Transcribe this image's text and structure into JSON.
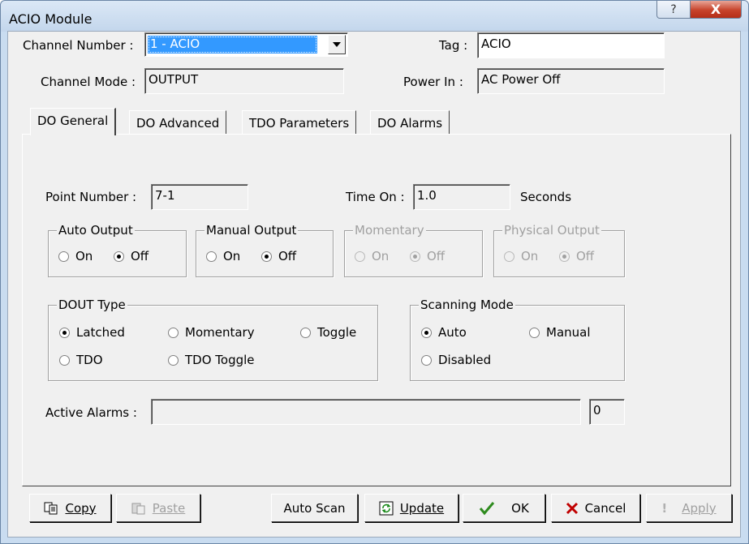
{
  "window": {
    "title": "ACIO Module",
    "help_button": "?",
    "close_button": "X"
  },
  "header": {
    "channel_number_label": "Channel Number :",
    "channel_number_value": "1 - ACIO",
    "tag_label": "Tag :",
    "tag_value": "ACIO",
    "channel_mode_label": "Channel Mode :",
    "channel_mode_value": "OUTPUT",
    "power_in_label": "Power In :",
    "power_in_value": "AC Power Off"
  },
  "tabs": [
    {
      "label": "DO General",
      "active": true
    },
    {
      "label": "DO Advanced",
      "active": false
    },
    {
      "label": "TDO Parameters",
      "active": false
    },
    {
      "label": "DO Alarms",
      "active": false
    }
  ],
  "general": {
    "point_number_label": "Point Number :",
    "point_number_value": "7-1",
    "time_on_label": "Time On :",
    "time_on_value": "1.0",
    "time_on_unit": "Seconds",
    "auto_output": {
      "title": "Auto Output",
      "on": "On",
      "off": "Off",
      "selected": "off"
    },
    "manual_output": {
      "title": "Manual Output",
      "on": "On",
      "off": "Off",
      "selected": "off"
    },
    "momentary": {
      "title": "Momentary",
      "on": "On",
      "off": "Off",
      "selected": "off"
    },
    "physical_output": {
      "title": "Physical Output",
      "on": "On",
      "off": "Off",
      "selected": "off"
    },
    "dout_type": {
      "title": "DOUT Type",
      "latched": "Latched",
      "momentary": "Momentary",
      "toggle": "Toggle",
      "tdo": "TDO",
      "tdo_toggle": "TDO Toggle",
      "selected": "latched"
    },
    "scanning_mode": {
      "title": "Scanning Mode",
      "auto": "Auto",
      "manual": "Manual",
      "disabled": "Disabled",
      "selected": "auto"
    },
    "active_alarms_label": "Active Alarms :",
    "active_alarms_value": "",
    "active_alarms_count": "0"
  },
  "buttons": {
    "copy": "Copy",
    "paste": "Paste",
    "auto_scan": "Auto Scan",
    "update": "Update",
    "ok": "OK",
    "cancel": "Cancel",
    "apply": "Apply"
  },
  "colors": {
    "selection": "#3399ff",
    "ok_check": "#2e8b1e",
    "cancel_x": "#c00000"
  }
}
